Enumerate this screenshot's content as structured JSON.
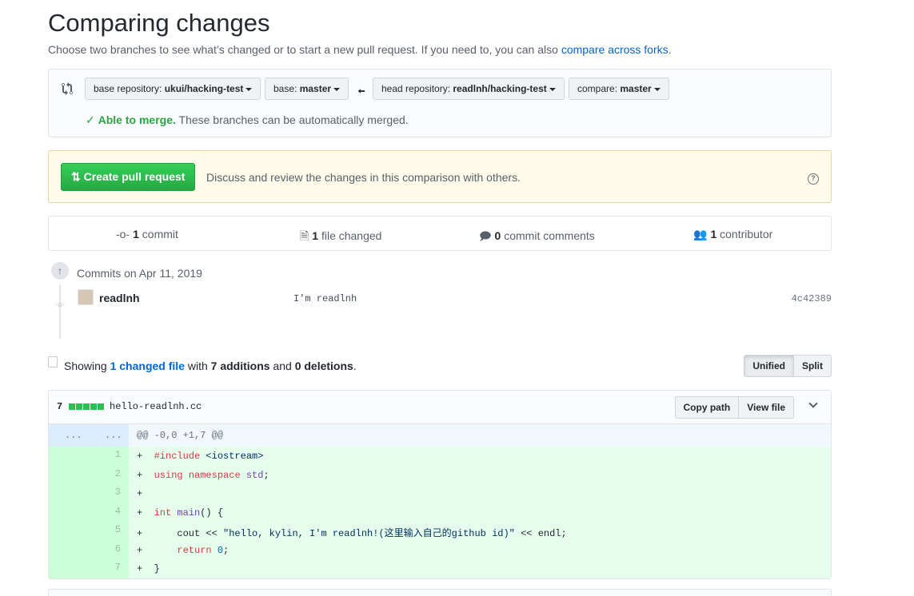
{
  "page": {
    "title": "Comparing changes",
    "subtitle_prefix": "Choose two branches to see what’s changed or to start a new pull request. If you need to, you can also ",
    "subtitle_link": "compare across forks",
    "subtitle_suffix": "."
  },
  "range": {
    "base_repo_label": "base repository: ",
    "base_repo_value": "ukui/hacking-test",
    "base_label": "base: ",
    "base_value": "master",
    "head_repo_label": "head repository: ",
    "head_repo_value": "readlnh/hacking-test",
    "compare_label": "compare: ",
    "compare_value": "master",
    "merge_ok": "Able to merge.",
    "merge_text": " These branches can be automatically merged."
  },
  "pr": {
    "button_label": "Create pull request",
    "description": "Discuss and review the changes in this comparison with others."
  },
  "numbers": {
    "commits_count": "1",
    "commits_label": " commit",
    "files_count": "1",
    "files_label": " file changed",
    "comments_count": "0",
    "comments_label": " commit comments",
    "contributors_count": "1",
    "contributors_label": " contributor"
  },
  "commits": {
    "date_heading": "Commits on Apr 11, 2019",
    "items": [
      {
        "author": "readlnh",
        "message": "I'm readlnh",
        "sha": "4c42389"
      }
    ]
  },
  "toc": {
    "showing": "Showing ",
    "changed_link": "1 changed file",
    "with": " with ",
    "additions": "7 additions",
    "and": " and ",
    "deletions": "0 deletions",
    "end": ".",
    "unified": "Unified",
    "split": "Split"
  },
  "file": {
    "diffstat": "7",
    "name": "hello-readlnh.cc",
    "copy_path": "Copy path",
    "view_file": "View file",
    "hunk_left": "...",
    "hunk_right": "...",
    "hunk_header": "@@ -0,0 +1,7 @@"
  },
  "colors": {
    "accent_link": "#0366d6",
    "success": "#28a745",
    "addition_bg": "#e6ffed",
    "addition_gutter": "#cdffd8"
  }
}
